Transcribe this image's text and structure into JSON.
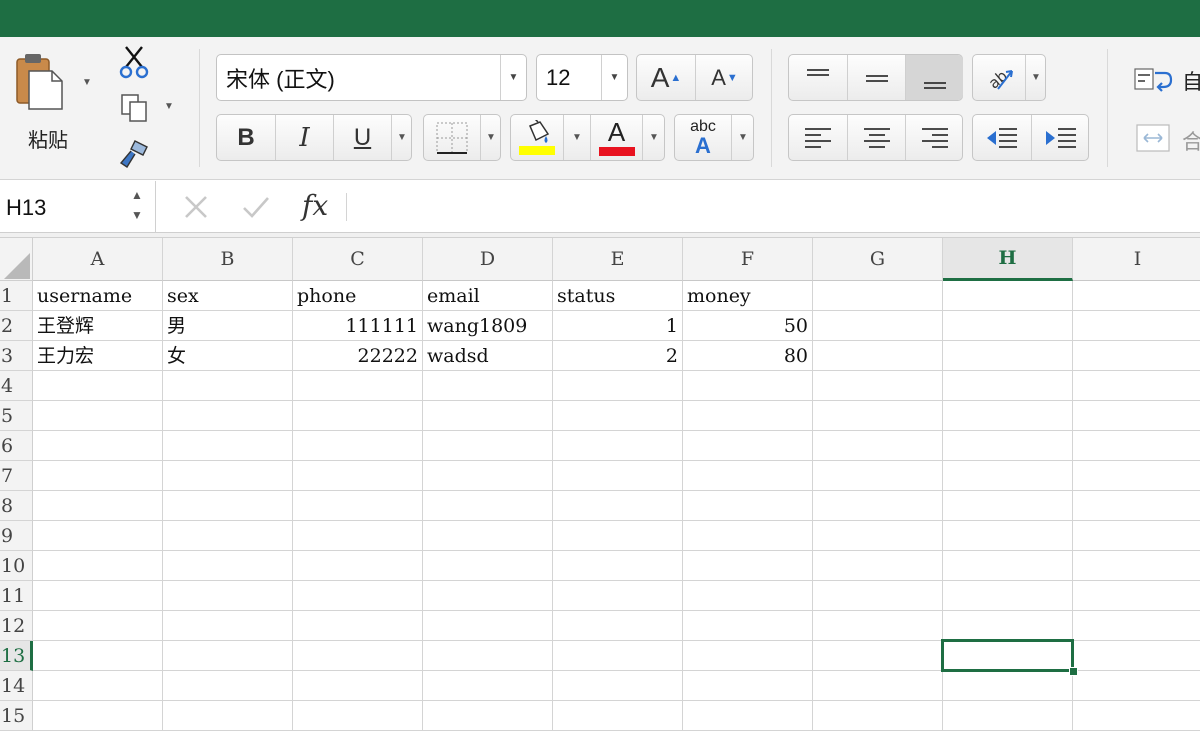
{
  "ribbon": {
    "clipboard": {
      "paste_label": "粘贴"
    },
    "font": {
      "name": "宋体 (正文)",
      "size": "12",
      "bold_label": "B",
      "italic_label": "I",
      "underline_label": "U",
      "grow_label": "A",
      "shrink_label": "A",
      "font_color_label": "A",
      "phonetic_top": "abc",
      "phonetic_bottom": "A"
    },
    "colors": {
      "highlight": "#ffff00",
      "font_color": "#e8121f",
      "accent": "#1e6e43"
    },
    "alignment": {
      "wrap_label": "自",
      "merge_label": "合"
    }
  },
  "formula_bar": {
    "name_box": "H13",
    "fx_label": "fx",
    "value": ""
  },
  "grid": {
    "columns": [
      "A",
      "B",
      "C",
      "D",
      "E",
      "F",
      "G",
      "H",
      "I"
    ],
    "selected_column": "H",
    "rows": [
      "1",
      "2",
      "3",
      "4",
      "5",
      "6",
      "7",
      "8",
      "9",
      "10",
      "11",
      "12",
      "13",
      "14",
      "15"
    ],
    "selected_row": "13",
    "cells": [
      [
        "username",
        "sex",
        "phone",
        "email",
        "status",
        "money"
      ],
      [
        "王登辉",
        "男",
        "111111",
        "wang1809",
        "1",
        "50"
      ],
      [
        "王力宏",
        "女",
        "22222",
        "wadsd",
        "2",
        "80"
      ]
    ],
    "active_cell": "H13"
  }
}
